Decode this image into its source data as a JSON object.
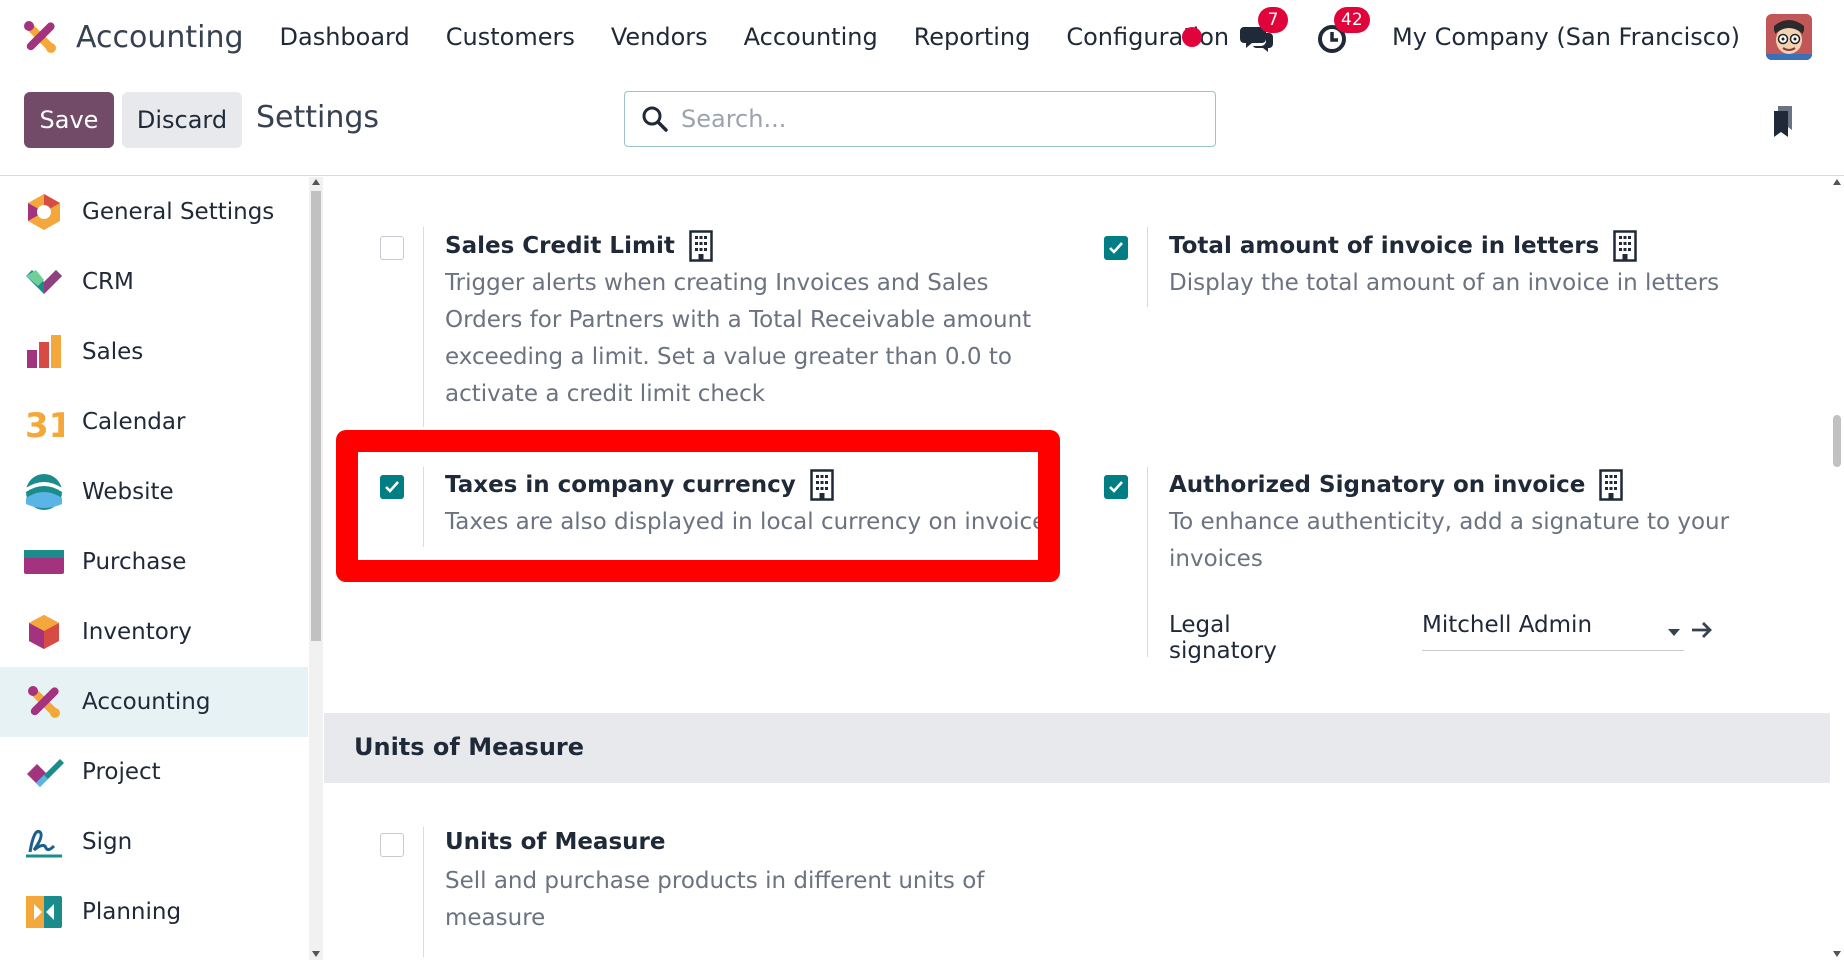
{
  "navbar": {
    "app_name": "Accounting",
    "menu": [
      "Dashboard",
      "Customers",
      "Vendors",
      "Accounting",
      "Reporting",
      "Configuration"
    ],
    "messages_badge": "7",
    "activities_badge": "42",
    "company": "My Company (San Francisco)"
  },
  "control_panel": {
    "save_label": "Save",
    "discard_label": "Discard",
    "title": "Settings",
    "search_placeholder": "Search..."
  },
  "sidebar": {
    "items": [
      {
        "label": "General Settings",
        "icon": "general-settings-icon"
      },
      {
        "label": "CRM",
        "icon": "crm-icon"
      },
      {
        "label": "Sales",
        "icon": "sales-icon"
      },
      {
        "label": "Calendar",
        "icon": "calendar-icon"
      },
      {
        "label": "Website",
        "icon": "website-icon"
      },
      {
        "label": "Purchase",
        "icon": "purchase-icon"
      },
      {
        "label": "Inventory",
        "icon": "inventory-icon"
      },
      {
        "label": "Accounting",
        "icon": "accounting-icon",
        "active": true
      },
      {
        "label": "Project",
        "icon": "project-icon"
      },
      {
        "label": "Sign",
        "icon": "sign-icon"
      },
      {
        "label": "Planning",
        "icon": "planning-icon"
      }
    ],
    "calendar_icon_text": "31"
  },
  "settings": {
    "sales_credit_limit": {
      "title": "Sales Credit Limit",
      "description": "Trigger alerts when creating Invoices and Sales Orders for Partners with a Total Receivable amount exceeding a limit. Set a value greater than 0.0 to activate a credit limit check",
      "checked": false
    },
    "total_in_letters": {
      "title": "Total amount of invoice in letters",
      "description": "Display the total amount of an invoice in letters",
      "checked": true
    },
    "taxes_company_currency": {
      "title": "Taxes in company currency",
      "description": "Taxes are also displayed in local currency on invoices",
      "checked": true
    },
    "authorized_signatory": {
      "title": "Authorized Signatory on invoice",
      "description": "To enhance authenticity, add a signature to your invoices",
      "checked": true,
      "signatory_label": "Legal signatory",
      "signatory_value": "Mitchell Admin"
    },
    "units_section": {
      "heading": "Units of Measure"
    },
    "units_of_measure": {
      "title": "Units of Measure",
      "description": "Sell and purchase products in different units of measure",
      "checked": false
    }
  },
  "colors": {
    "primary": "#714b67",
    "checkbox": "#017e84",
    "highlight": "#ff0000",
    "badge": "#e0043b"
  }
}
